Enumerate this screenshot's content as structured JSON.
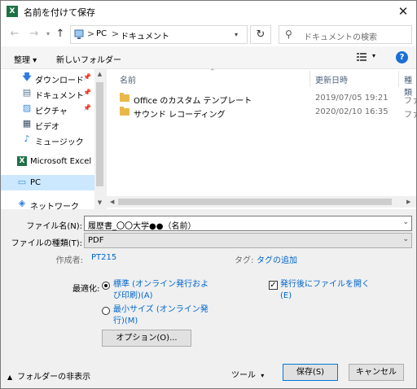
{
  "window": {
    "title": "名前を付けて保存",
    "app_icon": "X",
    "close_glyph": "✕"
  },
  "nav": {
    "back": "←",
    "forward": "→",
    "up": "↑",
    "path": [
      "PC",
      "ドキュメント"
    ],
    "path_sep": ">",
    "refresh": "↻",
    "search_placeholder": "ドキュメントの検索"
  },
  "toolbar": {
    "organize": "整理 ▾",
    "new_folder": "新しいフォルダー",
    "view_drop": "▾",
    "help": "?"
  },
  "sidebar": {
    "items": [
      {
        "label": "ダウンロード",
        "icon": "download-icon",
        "glyph": "🡇",
        "pinned": true
      },
      {
        "label": "ドキュメント",
        "icon": "documents-icon",
        "glyph": "▤",
        "pinned": true
      },
      {
        "label": "ピクチャ",
        "icon": "pictures-icon",
        "glyph": "▨",
        "pinned": true
      },
      {
        "label": "ビデオ",
        "icon": "videos-icon",
        "glyph": "▦",
        "pinned": false
      },
      {
        "label": "ミュージック",
        "icon": "music-icon",
        "glyph": "♪",
        "pinned": false
      },
      {
        "label": "Microsoft Excel",
        "icon": "excel-icon",
        "glyph": "X",
        "pinned": false
      },
      {
        "label": "PC",
        "icon": "pc-icon",
        "glyph": "▭",
        "pinned": false,
        "selected": true
      },
      {
        "label": "ネットワーク",
        "icon": "network-icon",
        "glyph": "◈",
        "pinned": false
      }
    ],
    "pin_glyph": "📌"
  },
  "files": {
    "columns": {
      "name": "名前",
      "date": "更新日時",
      "type": "種類"
    },
    "rows": [
      {
        "name": "Office のカスタム テンプレート",
        "date": "2019/07/05 19:21",
        "type": "ファ"
      },
      {
        "name": "サウンド レコーディング",
        "date": "2020/02/10 16:35",
        "type": "ファ"
      }
    ]
  },
  "form": {
    "filename_label": "ファイル名(N):",
    "filename_value": "履歴書_〇〇大学●●（名前）",
    "filetype_label": "ファイルの種類(T):",
    "filetype_value": "PDF",
    "author_label": "作成者:",
    "author_value": "PT215",
    "tag_label": "タグ:",
    "tag_value": "タグの追加",
    "optimize_label": "最適化:",
    "opt_standard_line1": "標準 (オンライン発行およ",
    "opt_standard_line2": "び印刷)(A)",
    "opt_min_line1": "最小サイズ (オンライン発",
    "opt_min_line2": "行)(M)",
    "open_after_line1": "発行後にファイルを開く",
    "open_after_line2": "(E)",
    "options_button": "オプション(O)...",
    "checkmark": "✓"
  },
  "footer": {
    "hide_folders": "フォルダーの非表示",
    "tools": "ツール",
    "save": "保存(S)",
    "cancel": "キャンセル"
  }
}
